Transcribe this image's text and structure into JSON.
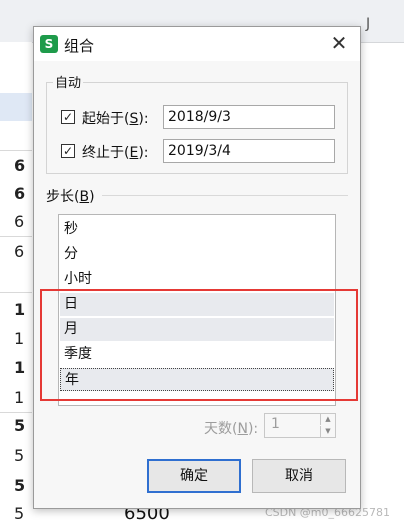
{
  "sheet": {
    "col_letters": [
      "J"
    ],
    "left_numbers": [
      "6",
      "6",
      "6",
      "6",
      "1",
      "1",
      "1",
      "1",
      "5",
      "5",
      "5",
      "5"
    ],
    "bottom_value": "6500",
    "watermark": "CSDN @m0_66625781"
  },
  "dialog": {
    "title": "组合",
    "app_icon_letter": "S",
    "close_glyph": "✕",
    "auto_group": {
      "label": "自动",
      "start": {
        "checked": true,
        "label_pre": "起始于(",
        "mnemonic": "S",
        "label_post": "):",
        "value": "2018/9/3"
      },
      "end": {
        "checked": true,
        "label_pre": "终止于(",
        "mnemonic": "E",
        "label_post": "):",
        "value": "2019/3/4"
      }
    },
    "step": {
      "label_pre": "步长(",
      "mnemonic": "B",
      "label_post": ")",
      "items": [
        "秒",
        "分",
        "小时",
        "日",
        "月",
        "季度",
        "年"
      ],
      "selected": [
        "日",
        "月",
        "年"
      ],
      "focused": "年"
    },
    "days": {
      "label_pre": "天数(",
      "mnemonic": "N",
      "label_post": "):",
      "value": "1"
    },
    "ok_label": "确定",
    "cancel_label": "取消"
  }
}
